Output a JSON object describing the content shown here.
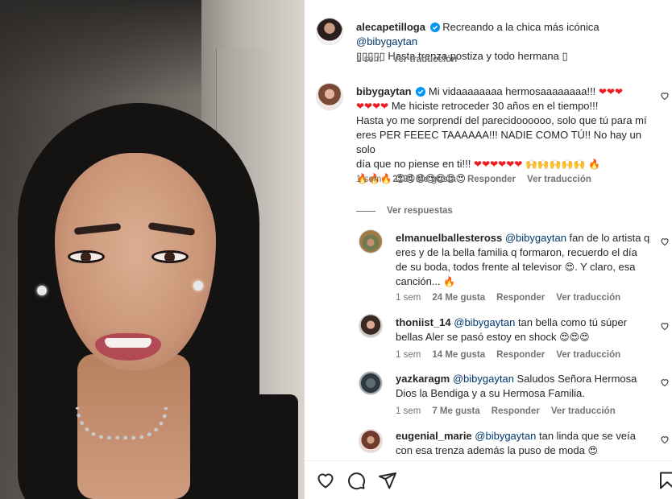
{
  "post": {
    "username": "alecapetilloga",
    "text_prefix": "Recreando a la chica más icónica ",
    "mention": "@bibygaytan",
    "line2": "▯▯▯▯▯ Hasta trenza postiza y todo hermana ▯",
    "time": "1 sem",
    "translate": "Ver traducción"
  },
  "comments": [
    {
      "username": "bibygaytan",
      "verified": true,
      "line1": "Mi vidaaaaaaaa hermosaaaaaaaa!!!",
      "line3": "Me hiciste retroceder 30 años en el tiempo!!!",
      "line4": "Hasta yo me sorprendí del parecidoooooo, solo que tú para mí",
      "line5": "eres PER FEEEC TAAAAAA!!! NADIE COMO TÚ!! No hay un solo",
      "line6": "día que no piense en ti!!!",
      "time": "1 sem",
      "likes": "2194 Me gusta",
      "reply": "Responder",
      "translate": "Ver traducción",
      "view_replies": "Ver respuestas"
    },
    {
      "username": "elmanuelballesteross",
      "mention": "@bibygaytan",
      "line1": " fan de lo artista q",
      "line2": "eres y de la bella familia q formaron, recuerdo el día",
      "line3": "de su boda, todos frente al televisor",
      "line3b": ". Y claro, esa",
      "line4": "canción...",
      "time": "1 sem",
      "likes": "24 Me gusta",
      "reply": "Responder",
      "translate": "Ver traducción"
    },
    {
      "username": "thoniist_14",
      "mention": "@bibygaytan",
      "line1": " tan bella como tú súper",
      "line2": "bellas Aler se pasó estoy en shock",
      "time": "1 sem",
      "likes": "14 Me gusta",
      "reply": "Responder",
      "translate": "Ver traducción"
    },
    {
      "username": "yazkaragm",
      "mention": "@bibygaytan",
      "line1": " Saludos Señora Hermosa",
      "line2": "Dios la Bendiga y a su Hermosa Familia.",
      "time": "1 sem",
      "likes": "7 Me gusta",
      "reply": "Responder",
      "translate": "Ver traducción"
    },
    {
      "username": "eugenial_marie",
      "mention": "@bibygaytan",
      "line1": " tan linda que se veía",
      "line2": "con esa trenza además la puso de moda"
    }
  ],
  "icons": {
    "like": "heart-icon",
    "comment": "comment-icon",
    "share": "share-icon",
    "save": "bookmark-icon"
  },
  "colors": {
    "link": "#00376b",
    "meta": "#737373",
    "verified": "#0095f6"
  }
}
